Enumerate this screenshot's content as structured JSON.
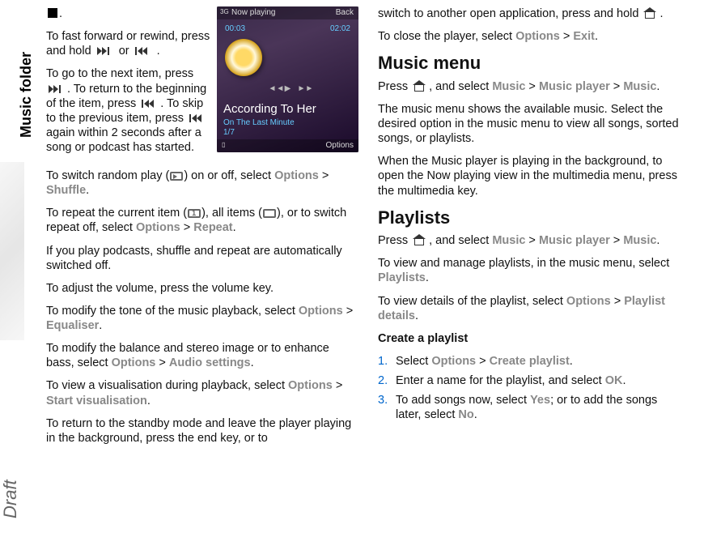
{
  "sidebar": {
    "tab": "Music folder",
    "watermark": "Draft"
  },
  "phone": {
    "now_playing": "Now playing",
    "back": "Back",
    "signal": "3G",
    "time_elapsed": "00:03",
    "time_total": "02:02",
    "song": "According To Her",
    "album": "On The Last Minute",
    "track": "1/7",
    "options": "Options"
  },
  "left": {
    "p1a": "To fast forward or rewind, press and hold ",
    "p1b": " or ",
    "p1c": ".",
    "p2a": "To go to the next item, press ",
    "p2b": ". To return to the beginning of the item, press ",
    "p2c": ". To skip to the previous item, press ",
    "p2d": " again within 2 seconds after a song or podcast has started.",
    "p3a": "To switch random play (",
    "p3b": ") on or off, select ",
    "p3_opt": "Options",
    "p3_gt": " > ",
    "p3_sh": "Shuffle",
    "p3c": ".",
    "p4a": "To repeat the current item (",
    "p4b": "), all items (",
    "p4c": "), or to switch repeat off, select ",
    "p4_opt": "Options",
    "p4_gt": " > ",
    "p4_rep": "Repeat",
    "p4d": ".",
    "p5": "If you play podcasts, shuffle and repeat are automatically switched off.",
    "p6": "To adjust the volume, press the volume key.",
    "p7a": "To modify the tone of the music playback, select ",
    "p7_opt": "Options",
    "p7_gt": " > ",
    "p7_eq": "Equaliser",
    "p7b": ".",
    "p8a": "To modify the balance and stereo image or to enhance bass, select ",
    "p8_opt": "Options",
    "p8_gt": " > ",
    "p8_as": "Audio settings",
    "p8b": ".",
    "p9a": "To view a visualisation during playback, select ",
    "p9_opt": "Options",
    "p9_gt": " > ",
    "p9_sv": "Start visualisation",
    "p9b": ".",
    "p10": "To return to the standby mode and leave the player playing in the background, press the end key, or to"
  },
  "right": {
    "p1a": "switch to another open application, press and hold ",
    "p1b": " .",
    "p2a": "To close the player, select ",
    "p2_opt": "Options",
    "p2_gt": " > ",
    "p2_ex": "Exit",
    "p2b": ".",
    "h1": "Music menu",
    "p3a": "Press ",
    "p3b": " , and select ",
    "p3_m1": "Music",
    "p3_gt1": " > ",
    "p3_m2": "Music player",
    "p3_gt2": " > ",
    "p3_m3": "Music",
    "p3c": ".",
    "p4": "The music menu shows the available music. Select the desired option in the music menu to view all songs, sorted songs, or playlists.",
    "p5": "When the Music player is playing in the background, to open the Now playing view in the multimedia menu, press the multimedia key.",
    "h2": "Playlists",
    "p6a": "Press ",
    "p6b": " , and select ",
    "p6_m1": "Music",
    "p6_gt1": " > ",
    "p6_m2": "Music player",
    "p6_gt2": " > ",
    "p6_m3": "Music",
    "p6c": ".",
    "p7a": "To view and manage playlists, in the music menu, select ",
    "p7_pl": "Playlists",
    "p7b": ".",
    "p8a": "To view details of the playlist, select ",
    "p8_opt": "Options",
    "p8_gt": " > ",
    "p8_pd": "Playlist details",
    "p8b": ".",
    "sub1": "Create a playlist",
    "li1a": "Select ",
    "li1_opt": "Options",
    "li1_gt": " > ",
    "li1_cp": "Create playlist",
    "li1b": ".",
    "li2a": "Enter a name for the playlist, and select ",
    "li2_ok": "OK",
    "li2b": ".",
    "li3a": "To add songs now, select ",
    "li3_yes": "Yes",
    "li3b": "; or to add the songs later, select ",
    "li3_no": "No",
    "li3c": ".",
    "n1": "1.",
    "n2": "2.",
    "n3": "3."
  }
}
